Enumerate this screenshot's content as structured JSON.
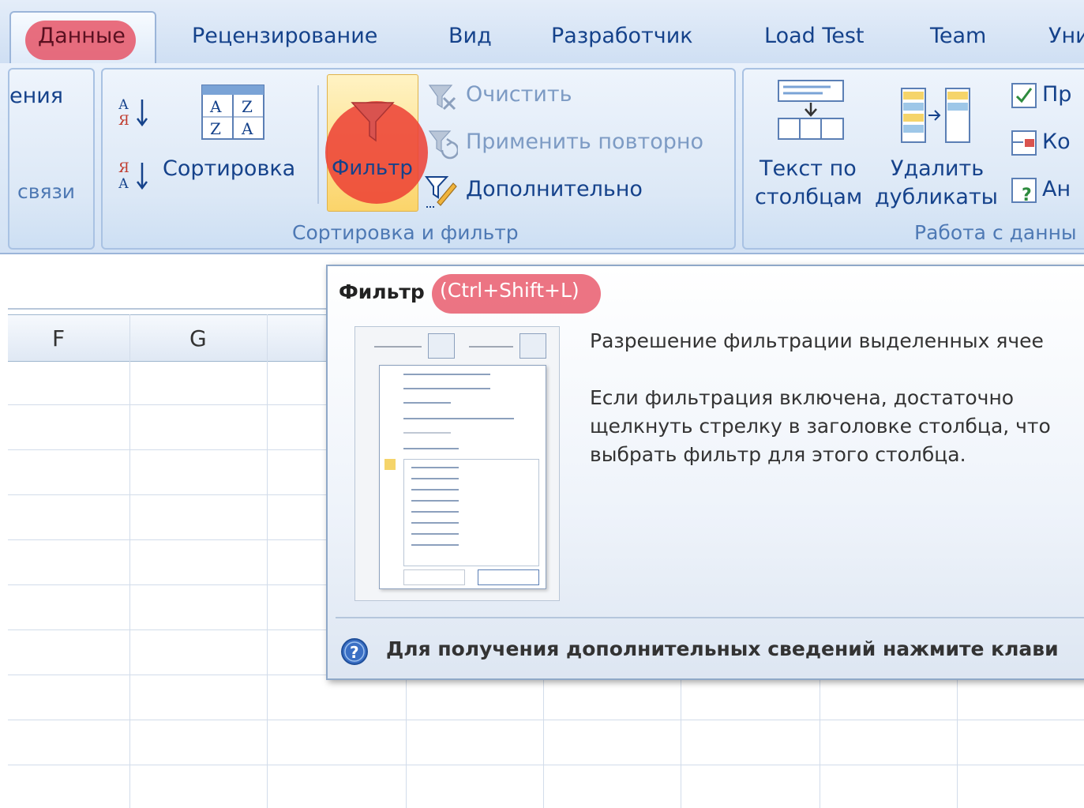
{
  "tabs": {
    "active": "Данные",
    "items": [
      "Рецензирование",
      "Вид",
      "Разработчик",
      "Load Test",
      "Team",
      "Уни"
    ]
  },
  "ribbon": {
    "connections_group": {
      "partial_label": "ения",
      "group_label": "связи"
    },
    "sort_filter_group": {
      "sort_label": "Сортировка",
      "filter_label": "Фильтр",
      "clear_label": "Очистить",
      "reapply_label": "Применить повторно",
      "advanced_label": "Дополнительно",
      "group_label": "Сортировка и фильтр"
    },
    "data_tools_group": {
      "text_to_columns_line1": "Текст по",
      "text_to_columns_line2": "столбцам",
      "remove_duplicates_line1": "Удалить",
      "remove_duplicates_line2": "дубликаты",
      "validation_partial": "Пр",
      "consolidate_partial": "Ко",
      "whatif_partial": "Ан",
      "group_label": "Работа с данны"
    }
  },
  "sheet": {
    "columns": [
      "F",
      "G"
    ]
  },
  "tooltip": {
    "title": "Фильтр",
    "shortcut": "(Ctrl+Shift+L)",
    "description": "Разрешение фильтрации выделенных ячее",
    "body_lines": [
      "Если фильтрация включена, достаточно",
      "щелкнуть стрелку в заголовке столбца, что",
      "выбрать фильтр для этого столбца."
    ],
    "help_text": "Для получения дополнительных сведений нажмите клави"
  },
  "colors": {
    "highlight": "#e6465a",
    "ribbon_text": "#15428b",
    "filter_active": "#fbd46a"
  }
}
